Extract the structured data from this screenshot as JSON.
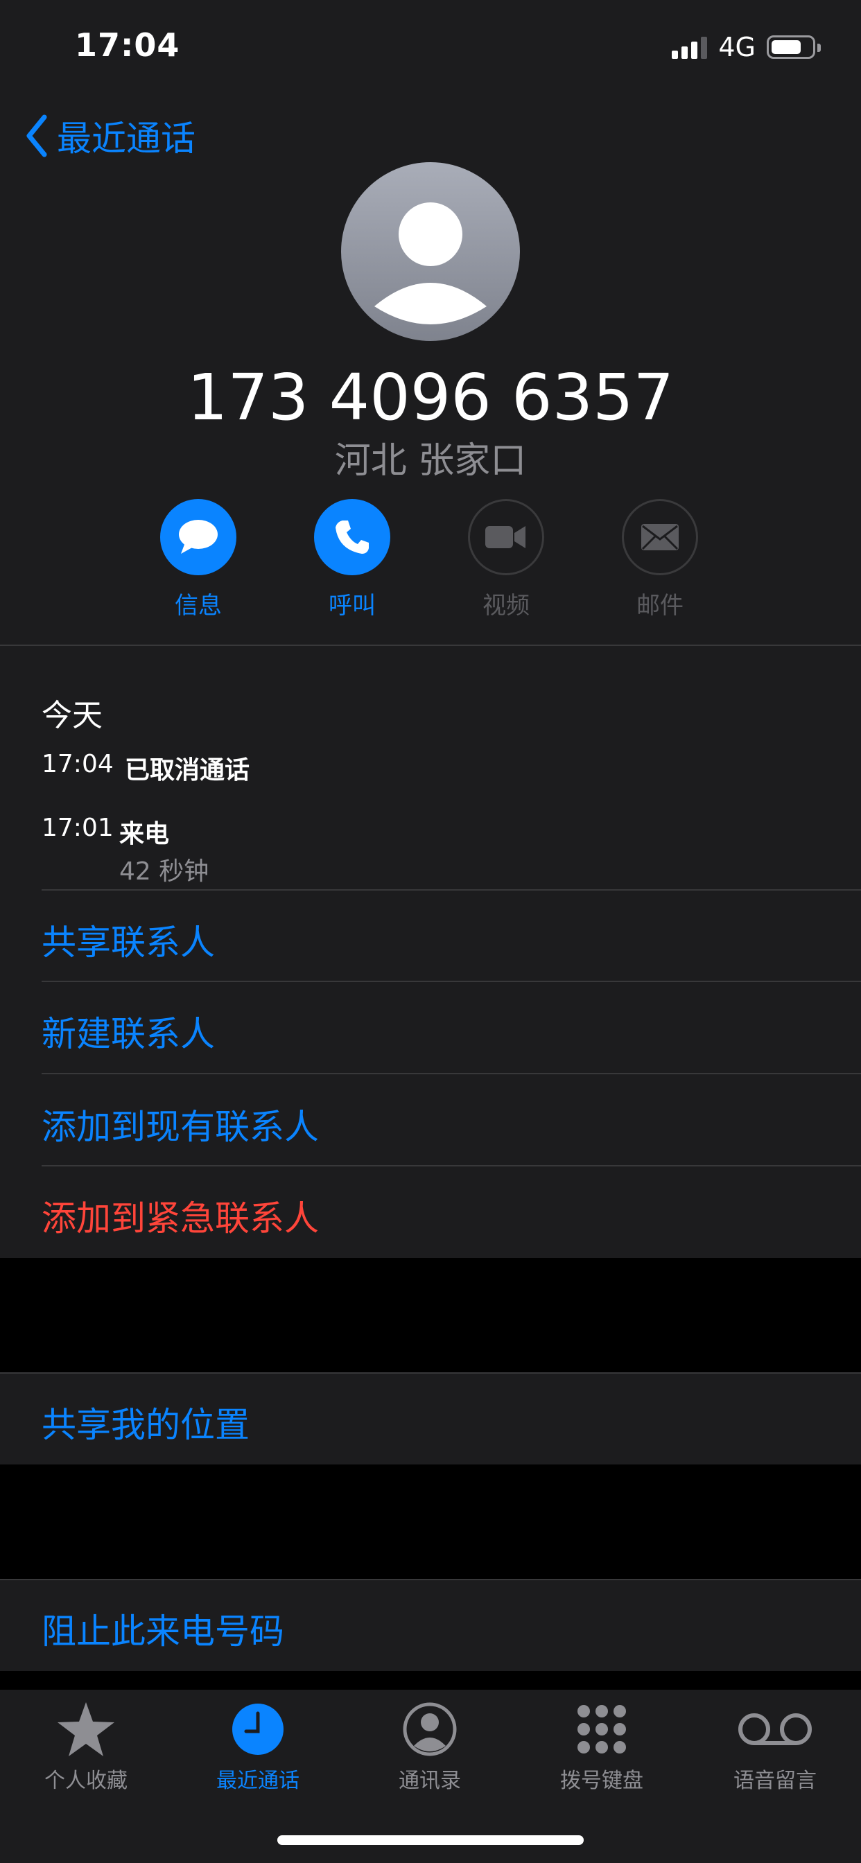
{
  "status_bar": {
    "time": "17:04",
    "network": "4G"
  },
  "nav": {
    "back_label": "最近通话"
  },
  "contact": {
    "number": "173 4096 6357",
    "location": "河北 张家口"
  },
  "actions": [
    {
      "label": "信息",
      "icon": "message-bubble-icon",
      "enabled": true
    },
    {
      "label": "呼叫",
      "icon": "phone-icon",
      "enabled": true
    },
    {
      "label": "视频",
      "icon": "video-camera-icon",
      "enabled": false
    },
    {
      "label": "邮件",
      "icon": "envelope-icon",
      "enabled": false
    }
  ],
  "recents": {
    "header": "今天",
    "calls": [
      {
        "time": "17:04",
        "type": "已取消通话",
        "duration": ""
      },
      {
        "time": "17:01",
        "type": "来电",
        "duration": "42 秒钟"
      }
    ]
  },
  "menu": {
    "share_contact": "共享联系人",
    "new_contact": "新建联系人",
    "add_to_existing": "添加到现有联系人",
    "add_to_emergency": "添加到紧急联系人",
    "share_location": "共享我的位置",
    "block_caller": "阻止此来电号码"
  },
  "tabs": [
    {
      "label": "个人收藏",
      "icon": "star-icon",
      "active": false
    },
    {
      "label": "最近通话",
      "icon": "clock-icon",
      "active": true
    },
    {
      "label": "通讯录",
      "icon": "person-circle-icon",
      "active": false
    },
    {
      "label": "拨号键盘",
      "icon": "keypad-icon",
      "active": false
    },
    {
      "label": "语音留言",
      "icon": "voicemail-icon",
      "active": false
    }
  ],
  "colors": {
    "accent": "#0a84ff",
    "destructive": "#ff453a",
    "background": "#1c1c1e"
  }
}
